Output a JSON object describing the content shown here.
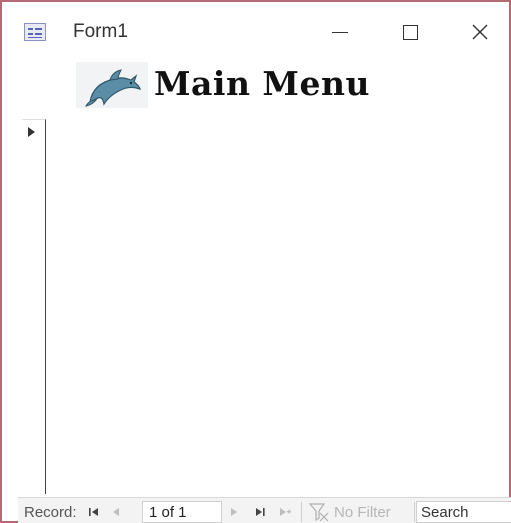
{
  "window": {
    "title": "Form1",
    "icons": {
      "app": "form-icon",
      "minimize": "minimize-icon",
      "maximize": "maximize-icon",
      "close": "close-icon"
    },
    "border_color": "#b46a73"
  },
  "header": {
    "logo_icon": "dolphin-logo",
    "title": "Main Menu"
  },
  "navigation": {
    "record_label": "Record:",
    "position_value": "1 of 1",
    "filter_label": "No Filter",
    "search_placeholder": "Search",
    "icons": {
      "first": "first-record-icon",
      "previous": "previous-record-icon",
      "next": "next-record-icon",
      "last": "last-record-icon",
      "new": "new-record-icon",
      "filter": "filter-icon"
    }
  }
}
